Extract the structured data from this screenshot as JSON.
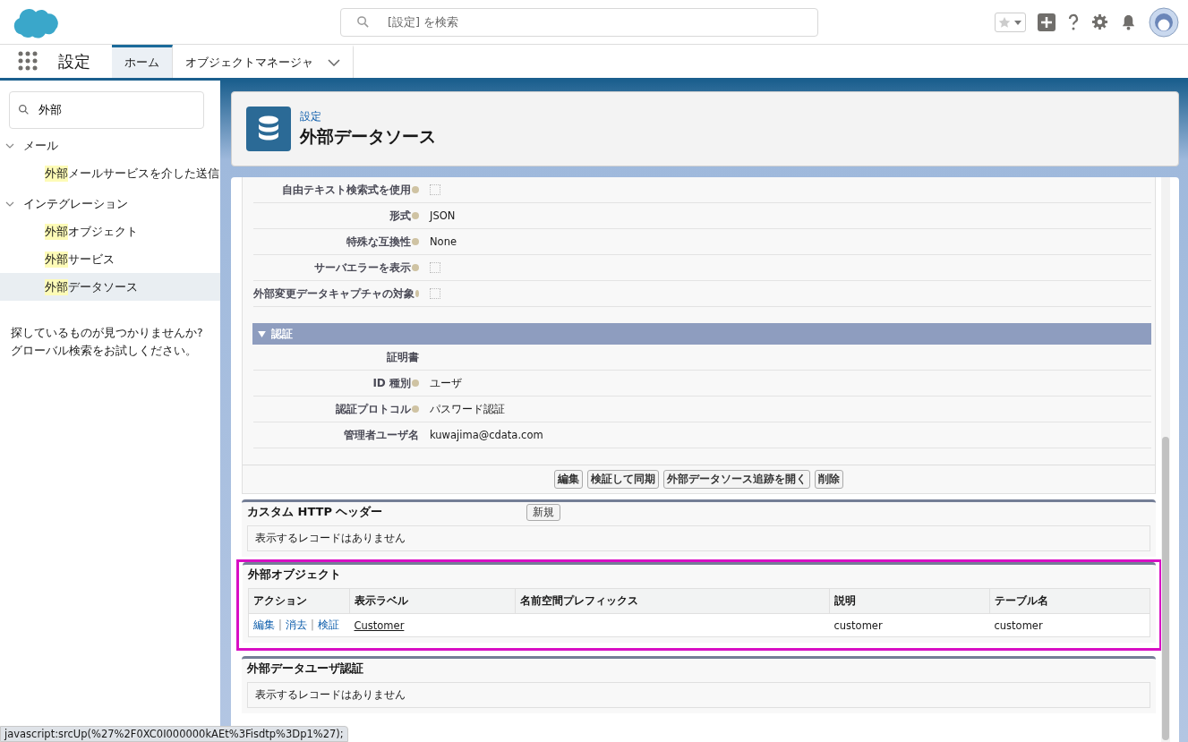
{
  "header": {
    "search": {
      "placeholder": "[設定] を検索"
    }
  },
  "nav": {
    "app_name": "設定",
    "tabs": [
      {
        "label": "ホーム",
        "selected": true,
        "menu": false
      },
      {
        "label": "オブジェクトマネージャ",
        "selected": false,
        "menu": true
      }
    ]
  },
  "sidebar": {
    "search": {
      "value": "外部"
    },
    "groups": [
      {
        "label": "メール",
        "expanded": true,
        "children": [
          {
            "highlight": "外部",
            "rest": "メールサービスを介した送信",
            "selected": false
          }
        ]
      },
      {
        "label": "インテグレーション",
        "expanded": true,
        "children": [
          {
            "highlight": "外部",
            "rest": "オブジェクト",
            "selected": false
          },
          {
            "highlight": "外部",
            "rest": "サービス",
            "selected": false
          },
          {
            "highlight": "外部",
            "rest": "データソース",
            "selected": true
          }
        ]
      }
    ],
    "hint": [
      "探しているものが見つかりませんか?",
      "グローバル検索をお試しください。"
    ]
  },
  "page_header": {
    "breadcrumb": "設定",
    "title": "外部データソース"
  },
  "detail": {
    "fields": [
      {
        "label": "自由テキスト検索式を使用",
        "help": true,
        "kind": "checkbox",
        "checked": false
      },
      {
        "label": "形式",
        "help": true,
        "kind": "text",
        "value": "JSON"
      },
      {
        "label": "特殊な互換性",
        "help": true,
        "kind": "text",
        "value": "None"
      },
      {
        "label": "サーバエラーを表示",
        "help": true,
        "kind": "checkbox",
        "checked": false
      },
      {
        "label": "外部変更データキャプチャの対象",
        "help": true,
        "kind": "checkbox",
        "checked": false
      }
    ],
    "section": {
      "title": "認証",
      "expanded": true,
      "fields": [
        {
          "label": "証明書",
          "help": false,
          "kind": "text"
        },
        {
          "label": "ID 種別",
          "help": true,
          "kind": "text",
          "value": "ユーザ"
        },
        {
          "label": "認証プロトコル",
          "help": true,
          "kind": "text",
          "value": "パスワード認証"
        },
        {
          "label": "管理者ユーザ名",
          "help": false,
          "kind": "text",
          "value": "kuwajima@cdata.com"
        }
      ]
    },
    "buttons": [
      "編集",
      "検証して同期",
      "外部データソース追跡を開く",
      "削除"
    ]
  },
  "related_lists": [
    {
      "title": "カスタム HTTP ヘッダー",
      "button": "新規",
      "empty": "表示するレコードはありません",
      "highlighted": false
    },
    {
      "title": "外部オブジェクト",
      "highlighted": true,
      "columns": [
        "アクション",
        "表示ラベル",
        "名前空間プレフィックス",
        "説明",
        "テーブル名"
      ],
      "rows": [
        {
          "cells": [
            {
              "links": [
                "編集",
                "消去",
                "検証"
              ],
              "separator": "|"
            },
            "Customer",
            "",
            "customer",
            "customer"
          ]
        }
      ]
    },
    {
      "title": "外部データユーザ認証",
      "empty": "表示するレコードはありません",
      "highlighted": false
    }
  ],
  "status_bar": "javascript:srcUp(%27%2F0XC0I000000kAEt%3Fisdtp%3Dp1%27);"
}
